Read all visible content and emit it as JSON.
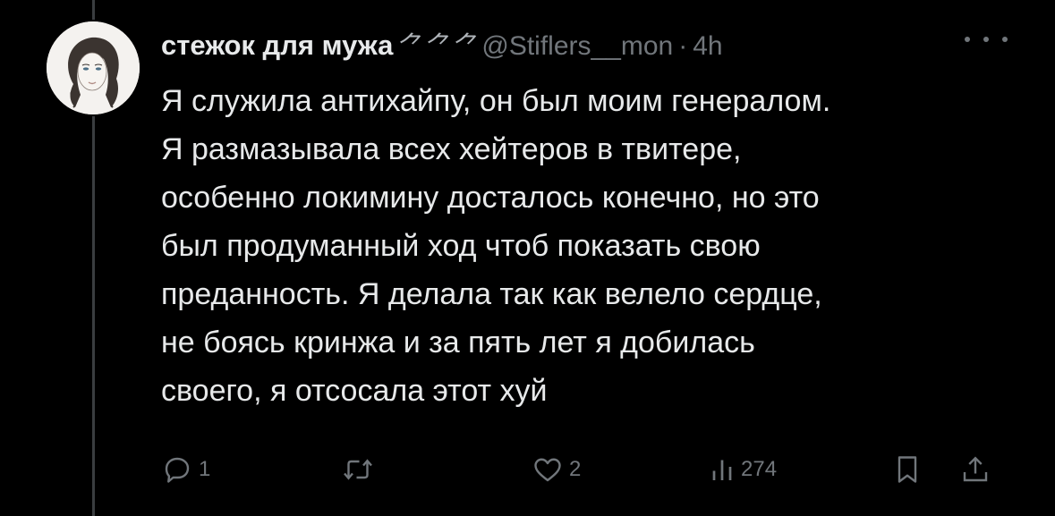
{
  "tweet": {
    "author": {
      "display_name": "стежок для мужа",
      "name_emoji": "⺈⺈⺈",
      "handle": "@Stiflers__mon",
      "avatar_icon": "avatar-portrait-drawing"
    },
    "separator": "·",
    "time": "4h",
    "text": "Я служила антихайпу, он был моим генералом.\nЯ размазывала всех хейтеров в твитере,\nособенно локимину досталось конечно, но это\nбыл продуманный ход чтоб показать свою\nпреданность. Я делала так как велело сердце,\nне боясь кринжа и за пять лет я добилась\nсвоего, я отсосала этот хуй",
    "actions": {
      "reply": {
        "icon": "reply-icon",
        "count": "1"
      },
      "retweet": {
        "icon": "retweet-icon",
        "count": ""
      },
      "like": {
        "icon": "heart-icon",
        "count": "2"
      },
      "views": {
        "icon": "views-chart-icon",
        "count": "274"
      },
      "bookmark": {
        "icon": "bookmark-icon"
      },
      "share": {
        "icon": "share-icon"
      }
    }
  },
  "colors": {
    "background": "#000000",
    "text_primary": "#e7e9ea",
    "text_secondary": "#71767b",
    "thread_line": "#3a3d40"
  }
}
